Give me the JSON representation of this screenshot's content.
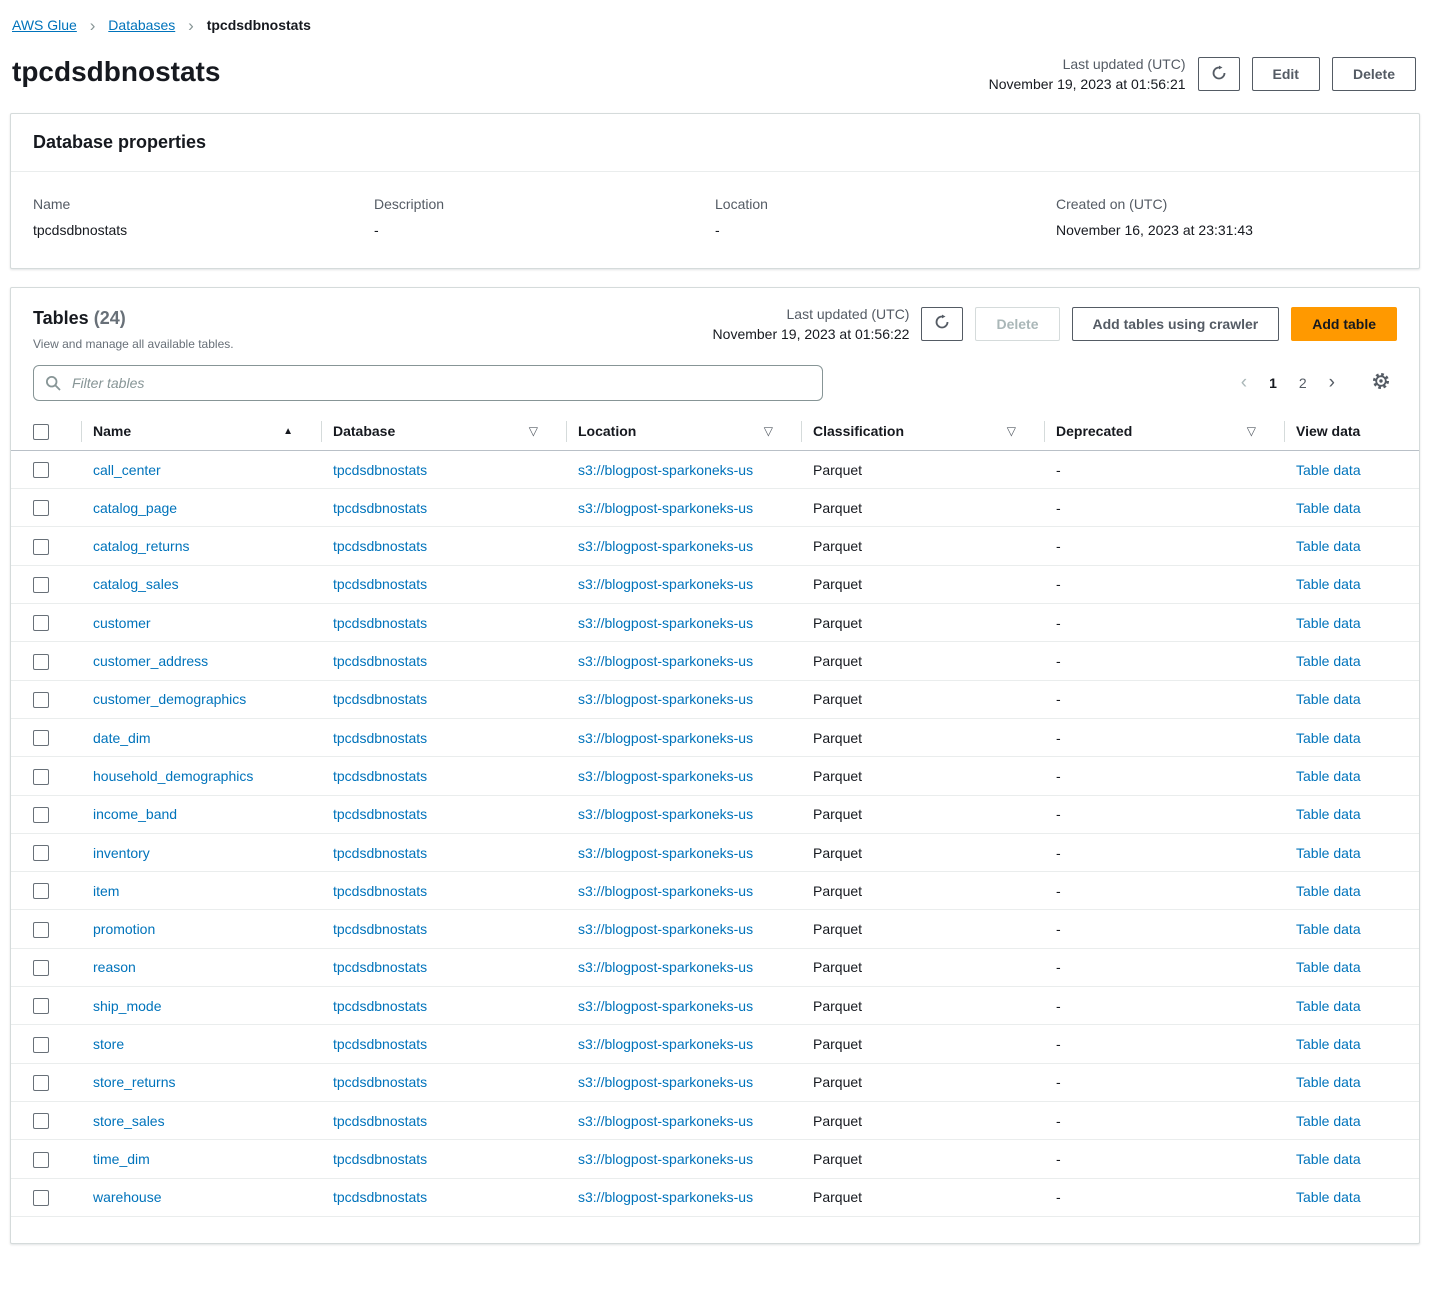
{
  "colors": {
    "link": "#0073bb",
    "accent": "#ff9900",
    "accent-text": "#16191f",
    "text": "#16191f",
    "muted": "#545b64",
    "faint": "#687078",
    "border": "#d5dbdb",
    "divider": "#eaeded"
  },
  "breadcrumb": {
    "items": [
      "AWS Glue",
      "Databases",
      "tpcdsdbnostats"
    ]
  },
  "header": {
    "title": "tpcdsdbnostats",
    "last_updated_label": "Last updated (UTC)",
    "last_updated_value": "November 19, 2023 at 01:56:21",
    "edit_label": "Edit",
    "delete_label": "Delete"
  },
  "properties": {
    "title": "Database properties",
    "fields": [
      {
        "label": "Name",
        "value": "tpcdsdbnostats"
      },
      {
        "label": "Description",
        "value": "-"
      },
      {
        "label": "Location",
        "value": "-"
      },
      {
        "label": "Created on (UTC)",
        "value": "November 16, 2023 at 23:31:43"
      }
    ]
  },
  "tables_panel": {
    "title": "Tables",
    "count": "(24)",
    "subtitle": "View and manage all available tables.",
    "last_updated_label": "Last updated (UTC)",
    "last_updated_value": "November 19, 2023 at 01:56:22",
    "delete_label": "Delete",
    "add_crawler_label": "Add tables using crawler",
    "add_table_label": "Add table",
    "filter_placeholder": "Filter tables",
    "pagination": {
      "pages": [
        "1",
        "2"
      ],
      "current": "1"
    },
    "columns": [
      "Name",
      "Database",
      "Location",
      "Classification",
      "Deprecated",
      "View data"
    ],
    "row_common": {
      "database": "tpcdsdbnostats",
      "location": "s3://blogpost-sparkoneks-us",
      "classification": "Parquet",
      "deprecated": "-",
      "view_data": "Table data"
    },
    "rows": [
      {
        "name": "call_center"
      },
      {
        "name": "catalog_page"
      },
      {
        "name": "catalog_returns"
      },
      {
        "name": "catalog_sales"
      },
      {
        "name": "customer"
      },
      {
        "name": "customer_address"
      },
      {
        "name": "customer_demographics"
      },
      {
        "name": "date_dim"
      },
      {
        "name": "household_demographics"
      },
      {
        "name": "income_band"
      },
      {
        "name": "inventory"
      },
      {
        "name": "item"
      },
      {
        "name": "promotion"
      },
      {
        "name": "reason"
      },
      {
        "name": "ship_mode"
      },
      {
        "name": "store"
      },
      {
        "name": "store_returns"
      },
      {
        "name": "store_sales"
      },
      {
        "name": "time_dim"
      },
      {
        "name": "warehouse"
      }
    ]
  }
}
